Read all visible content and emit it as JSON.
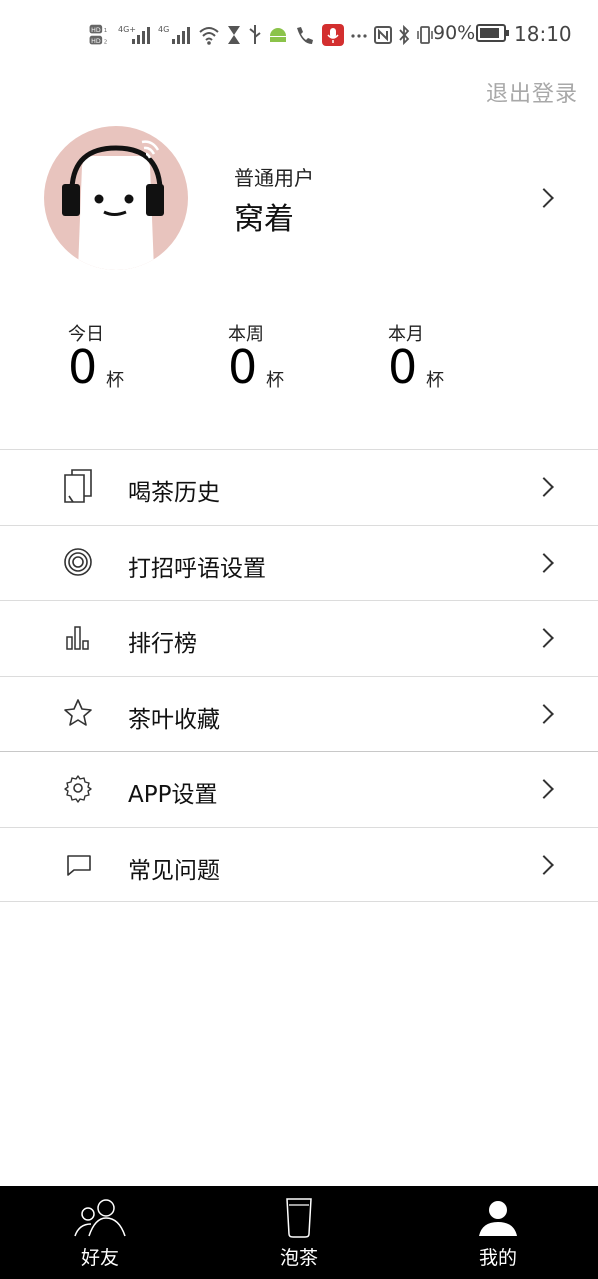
{
  "status_bar": {
    "battery": "90%",
    "time": "18:10",
    "icons": [
      "hd-icon",
      "signal-4g-icon",
      "signal-4g-icon",
      "wifi-icon",
      "hourglass-icon",
      "usb-icon",
      "android-icon",
      "call-icon",
      "mic-icon",
      "more-icon",
      "nfc-icon",
      "bluetooth-icon",
      "vibrate-icon",
      "battery-icon"
    ]
  },
  "header": {
    "logout_label": "退出登录"
  },
  "profile": {
    "user_type": "普通用户",
    "name": "窝着"
  },
  "stats": [
    {
      "label": "今日",
      "value": "0",
      "unit": "杯"
    },
    {
      "label": "本周",
      "value": "0",
      "unit": "杯"
    },
    {
      "label": "本月",
      "value": "0",
      "unit": "杯"
    }
  ],
  "menu": [
    {
      "label": "喝茶历史",
      "icon": "history-icon"
    },
    {
      "label": "打招呼语设置",
      "icon": "target-icon"
    },
    {
      "label": "排行榜",
      "icon": "bar-chart-icon"
    },
    {
      "label": "茶叶收藏",
      "icon": "star-icon"
    },
    {
      "label": "APP设置",
      "icon": "gear-icon"
    },
    {
      "label": "常见问题",
      "icon": "chat-icon"
    }
  ],
  "bottom_nav": [
    {
      "label": "好友",
      "icon": "friends-icon"
    },
    {
      "label": "泡茶",
      "icon": "cup-icon"
    },
    {
      "label": "我的",
      "icon": "user-icon"
    }
  ],
  "colors": {
    "avatar_bg": "#e8c4be",
    "nav_bg": "#000000",
    "logout_text": "#a8a8a8"
  }
}
